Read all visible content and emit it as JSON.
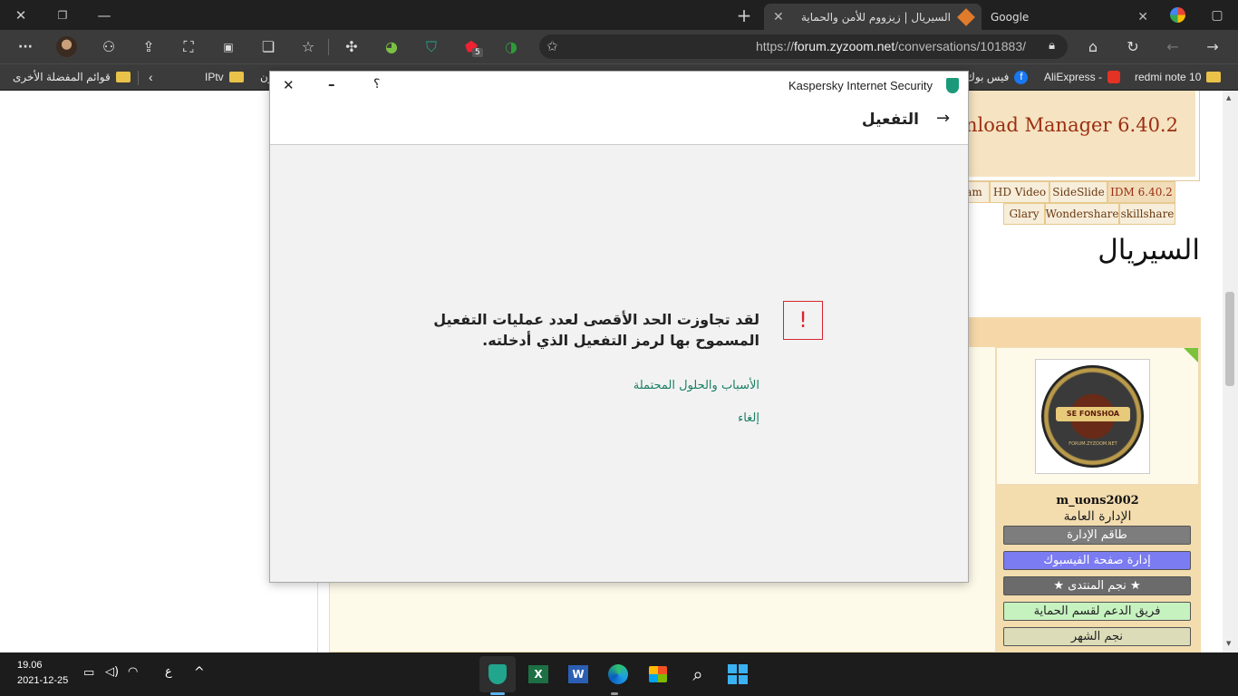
{
  "browser": {
    "tabs": [
      {
        "label": "Google"
      },
      {
        "label": "السيريال | زيزووم للأمن والحماية"
      }
    ],
    "new_tab": "+",
    "url_prefix": "https://",
    "url_host": "forum.zyzoom.net",
    "url_path": "/conversations/101883/",
    "ext_badge": "5",
    "more": "···"
  },
  "bookmarks": {
    "items": [
      {
        "label": "redmi note 10"
      },
      {
        "label": "AliExpress -"
      },
      {
        "label": "فيس بوك"
      },
      {
        "label": "ون"
      },
      {
        "label": "IPtv"
      },
      {
        "label": "قوائم المفضلة الأخرى"
      }
    ]
  },
  "page": {
    "banner_text": "nload Manager 6.40.2",
    "nav_row1": [
      "am",
      "HD Video",
      "SideSlide",
      "IDM 6.40.2"
    ],
    "nav_row2": [
      "Glary",
      "Wondershare",
      "skillshare"
    ],
    "heading": "السيريال",
    "username": "m_uons2002",
    "user_title": "الإدارة العامة",
    "avatar_text": "SE FONSHOA",
    "avatar_sub": "FORUM.ZYZOOM.NET",
    "ranks": [
      {
        "label": "طاقم الإدارة",
        "bg": "#7d7d7d",
        "fg": "#ffffff"
      },
      {
        "label": "إدارة صفحة الفيسبوك",
        "bg": "#7b7bf2",
        "fg": "#ffffff"
      },
      {
        "label": "★ نجم المنتدى ★",
        "bg": "#6b6b6b",
        "fg": "#ffffff"
      },
      {
        "label": "فريق الدعم لقسم الحماية",
        "bg": "#c6f2c0",
        "fg": "#222222"
      },
      {
        "label": "نجم الشهر",
        "bg": "#dcdcb8",
        "fg": "#222222"
      }
    ]
  },
  "dialog": {
    "app_title": "Kaspersky Internet Security",
    "help": "؟",
    "minimize": "–",
    "close": "✕",
    "back_arrow": "→",
    "heading": "التفعيل",
    "warning_mark": "!",
    "message_line1": "لقد تجاوزت الحد الأقصى لعدد عمليات التفعيل",
    "message_line2": "المسموح بها لرمز التفعيل الذي أدخلته.",
    "link_reasons": "الأسباب والحلول المحتملة",
    "link_cancel": "إلغاء",
    "accent": "#1a7f64",
    "warning_color": "#d9252f"
  },
  "taskbar": {
    "time": "19.06",
    "date": "2021-12-25",
    "lang": "ع",
    "chevron": "^"
  }
}
